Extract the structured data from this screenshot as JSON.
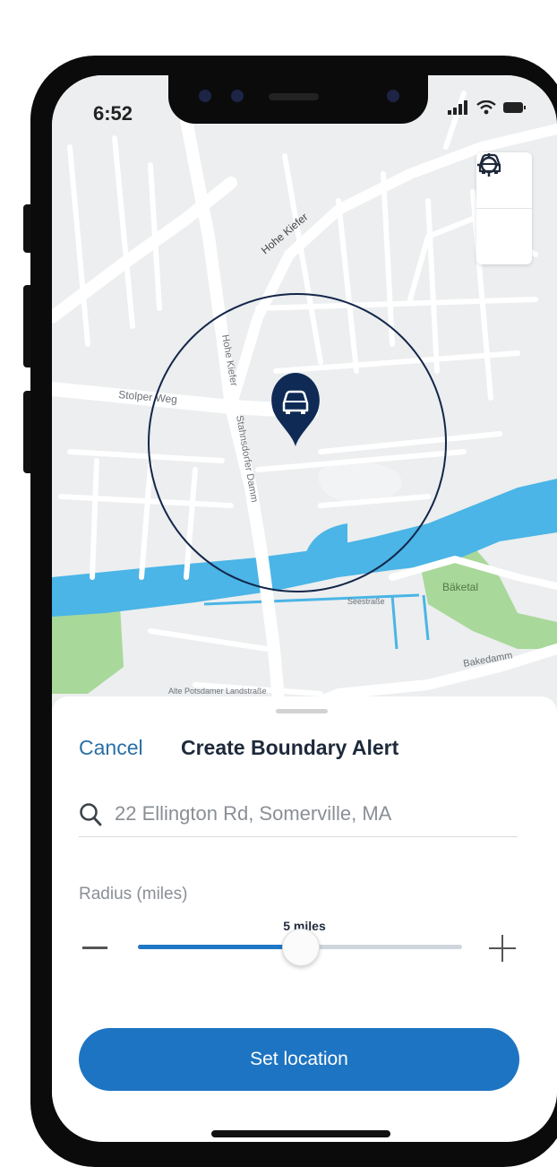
{
  "status_bar": {
    "time": "6:52"
  },
  "map": {
    "boundary_radius_miles": 5,
    "labels": {
      "stolper_weg": "Stolper Weg",
      "hohe_kiefer": "Hohe Kiefer",
      "hohe_kiefer_vertical": "Hohe Kiefer",
      "stahnsdorfer_damm": "Stahnsdorfer Damm",
      "baketal": "Bäketal",
      "bakedamm": "Bakedamm",
      "seestrasse": "Seestraße",
      "landstrasse": "Alte Potsdamer Landstraße"
    },
    "controls": [
      "locate-icon",
      "car-icon"
    ],
    "pin_icon": "car-icon"
  },
  "sheet": {
    "cancel_label": "Cancel",
    "title": "Create Boundary Alert",
    "search": {
      "icon": "search-icon",
      "value": "22 Ellington Rd, Somerville, MA"
    },
    "radius_label": "Radius (miles)",
    "radius_value_label": "5 miles",
    "slider_fraction": 0.5,
    "set_location_label": "Set location"
  },
  "colors": {
    "accent": "#1d74c2",
    "pin": "#0e2a55",
    "boundary": "#13264a",
    "water": "#4ab5e6",
    "park": "#a8d89a"
  }
}
